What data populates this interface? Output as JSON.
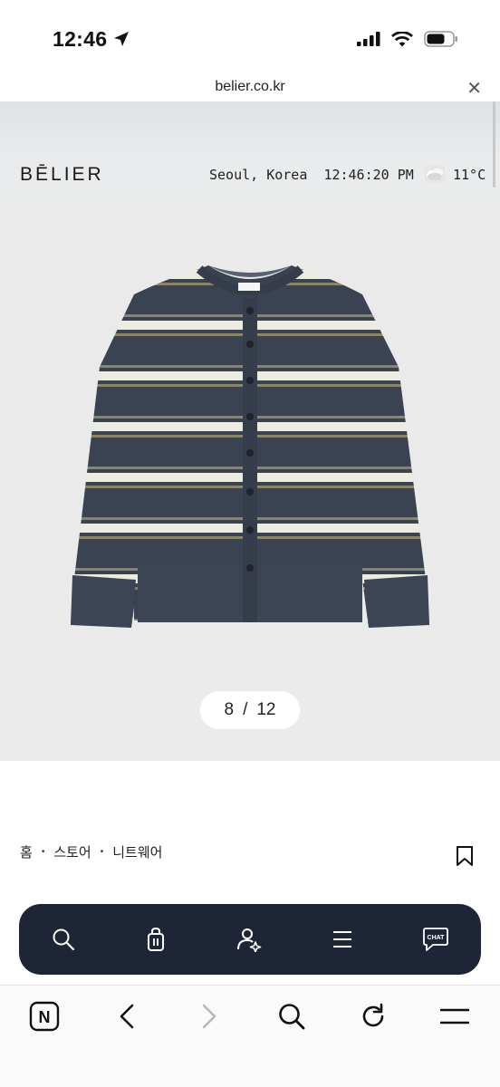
{
  "status_bar": {
    "time": "12:46",
    "icons": [
      "location-arrow-icon",
      "cellular-signal-icon",
      "wifi-icon",
      "battery-icon"
    ]
  },
  "browser": {
    "url": "belier.co.kr"
  },
  "header": {
    "logo": "BĒLIER",
    "city": "Seoul, Korea",
    "clock": "12:46:20 PM",
    "temperature": "11°C",
    "weather_icon": "cloudy-weather-icon"
  },
  "gallery": {
    "current": "8",
    "separator": "/",
    "total": "12",
    "colors": {
      "sweater_base": "#3b4352",
      "stripe_light": "#e9ecdf",
      "stripe_olive": "#8a8565"
    }
  },
  "breadcrumb": {
    "items": [
      "홈",
      "스토어",
      "니트웨어"
    ],
    "separator": "•"
  },
  "floating_nav": {
    "items": [
      "search-icon",
      "shopping-bag-icon",
      "account-icon",
      "menu-icon",
      "chat-icon"
    ],
    "chat_label": "CHAT",
    "background": "#1e2536"
  },
  "browser_toolbar": {
    "items": [
      "naver-home-icon",
      "back-icon",
      "forward-icon",
      "search-icon",
      "refresh-icon",
      "menu-icon"
    ],
    "home_label": "N"
  }
}
